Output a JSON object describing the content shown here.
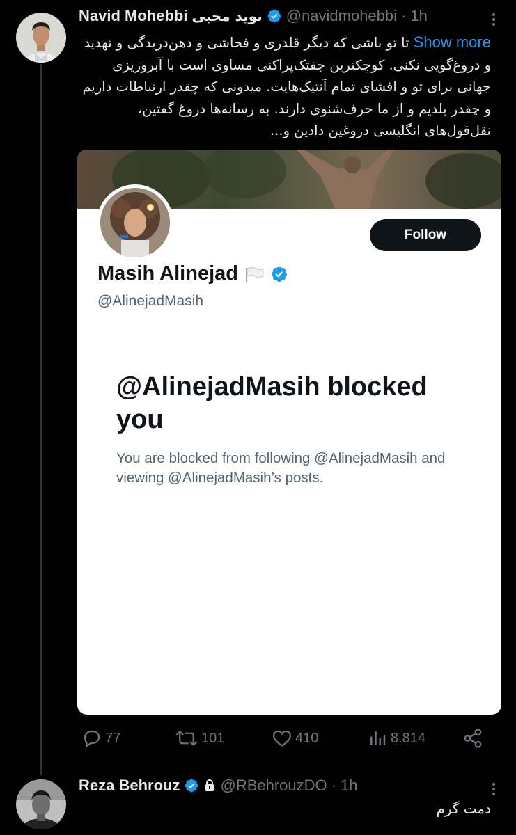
{
  "tweet1": {
    "author_name": "Navid Mohebbi",
    "author_name_fa": "نوید محبی",
    "handle": "@navidmohebbi",
    "separator": "·",
    "time": "1h",
    "text": "تا تو باشی که دیگر قلدری و فحاشی و دهن‌دریدگی و تهدید و دروغ‌گویی نکنی. کوچکترین جفتک‌پراکنی مساوی است با آبروریزی جهانی برای تو و افشای تمام آنتیک‌هایت. میدونی که چقدر ارتباطات داریم و چقدر بلدیم و از ما حرف‌شنوی دارند. به رسانه‌ها دروغ گفتین، نقل‌قول‌های انگلیسی دروغین دادین و...",
    "show_more": "Show more",
    "card": {
      "name": "Masih Alinejad",
      "handle": "@AlinejadMasih",
      "follow_label": "Follow",
      "blocked_title": "@AlinejadMasih blocked you",
      "blocked_desc": "You are blocked from following @AlinejadMasih and viewing @AlinejadMasih’s posts."
    },
    "stats": {
      "replies": "77",
      "reposts": "101",
      "likes": "410",
      "views": "8.814"
    },
    "icons": [
      "reply-icon",
      "repost-icon",
      "like-icon",
      "views-icon",
      "share-icon",
      "verified-badge-icon",
      "more-options-icon",
      "white-flag-icon"
    ]
  },
  "tweet2": {
    "author_name": "Reza Behrouz",
    "handle": "@RBehrouzDO",
    "separator": "·",
    "time": "1h",
    "text": "دمت گرم",
    "icons": [
      "verified-badge-icon",
      "lock-icon",
      "more-options-icon"
    ]
  },
  "colors": {
    "background": "#000000",
    "text": "#e7e9ea",
    "muted": "#71767b",
    "accent": "#1d9bf0",
    "verified": "#1d9bf0",
    "card_bg": "#ffffff",
    "card_text": "#0f1419"
  }
}
